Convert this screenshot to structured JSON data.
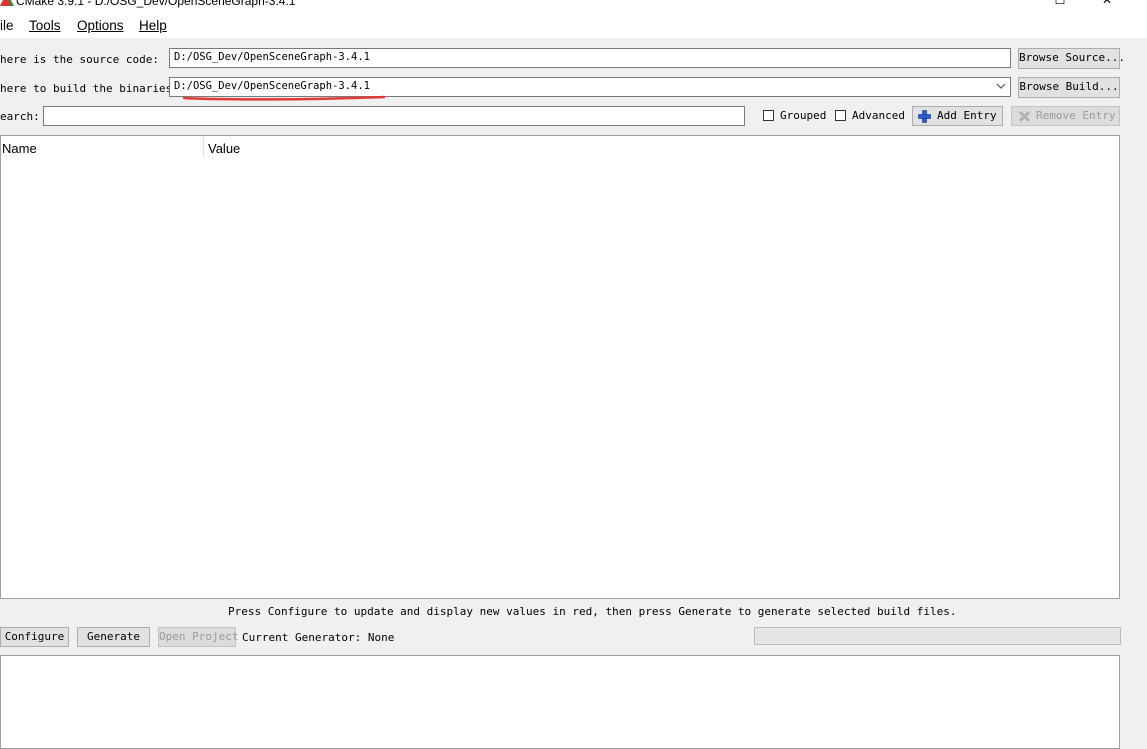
{
  "window": {
    "title": "CMake 3.9.1 - D:/OSG_Dev/OpenSceneGraph-3.4.1",
    "minimize_icon": "minimize-icon",
    "maximize_icon": "maximize-icon",
    "close_icon": "close-icon"
  },
  "menu": {
    "items": [
      {
        "label": "ile",
        "underline_index": -1
      },
      {
        "label": "Tools",
        "underline_index": 0
      },
      {
        "label": "Options",
        "underline_index": 0
      },
      {
        "label": "Help",
        "underline_index": 0
      }
    ]
  },
  "paths": {
    "source_label": "here is the source code:",
    "source_value": "D:/OSG_Dev/OpenSceneGraph-3.4.1",
    "browse_source_label": "Browse Source...",
    "build_label": "here to build the binaries:",
    "build_value": "D:/OSG_Dev/OpenSceneGraph-3.4.1",
    "browse_build_label": "Browse Build..."
  },
  "search": {
    "label": "earch:",
    "value": "",
    "grouped_label": "Grouped",
    "grouped_checked": false,
    "advanced_label": "Advanced",
    "advanced_checked": false,
    "add_entry_label": "Add Entry",
    "remove_entry_label": "Remove Entry"
  },
  "table": {
    "columns": [
      "Name",
      "Value"
    ],
    "rows": []
  },
  "status": {
    "message": "Press Configure to update and display new values in red, then press Generate to generate selected build files.",
    "configure_label": "Configure",
    "generate_label": "Generate",
    "open_project_label": "Open Project",
    "current_generator": "Current Generator: None",
    "progress": 0
  },
  "annotation": {
    "color": "#e53935"
  }
}
